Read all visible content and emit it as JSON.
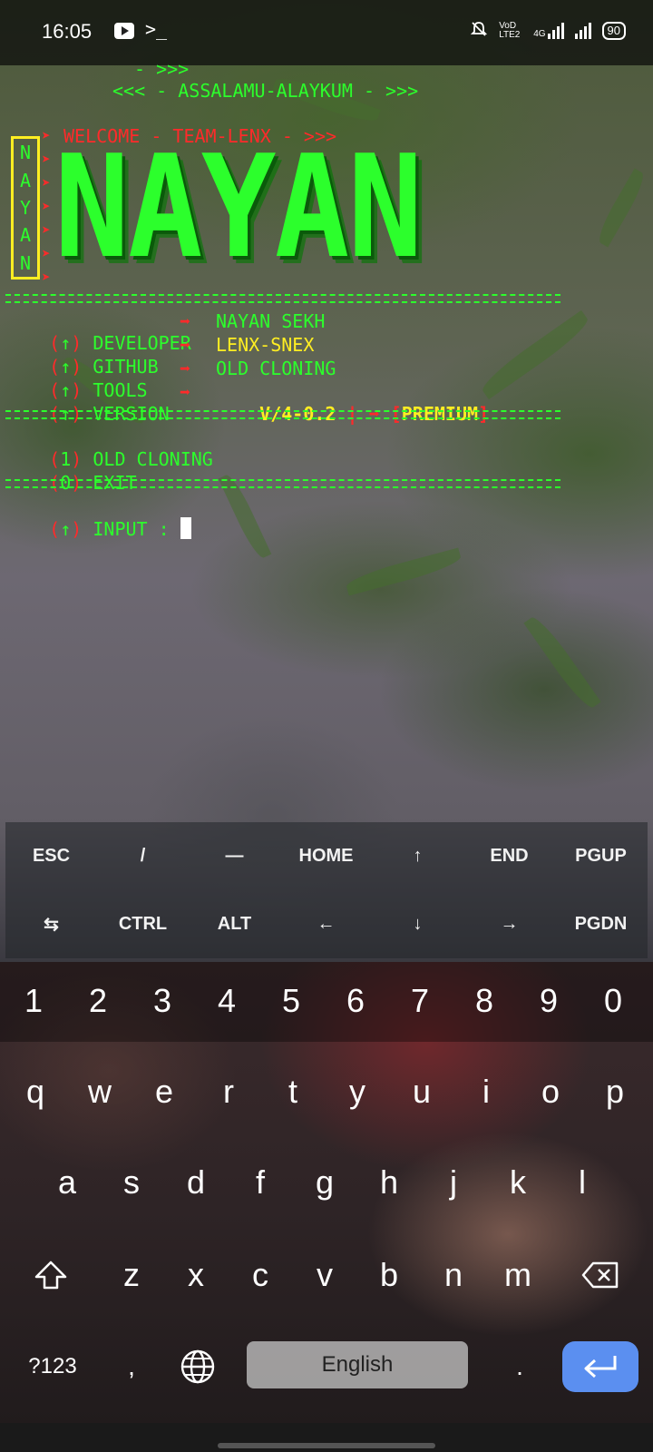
{
  "status_bar": {
    "time": "16:05",
    "network_label": "VoD LTE2",
    "signal_label": "4G",
    "battery": "90",
    "icons": [
      "youtube-icon",
      "terminal-icon",
      "mute-bell-icon",
      "signal-icon",
      "signal-icon",
      "battery-icon"
    ]
  },
  "terminal": {
    "greeting_top": "- >>>",
    "greeting": "<<< - ASSALAMU-ALAYKUM - >>>",
    "welcome": "WELCOME - TEAM-LENX - >>>",
    "side_letters": [
      "N",
      "A",
      "Y",
      "A",
      "N"
    ],
    "logo": "NAYAN",
    "info": [
      {
        "prefix": "(",
        "bullet": "↑",
        "suffix": ")",
        "label": "DEVELOPER",
        "arrow": "➡",
        "value": "NAYAN SEKH",
        "value_color": "green"
      },
      {
        "prefix": "(",
        "bullet": "↑",
        "suffix": ")",
        "label": "GITHUB",
        "arrow": "➡",
        "value": "LENX-SNEX",
        "value_color": "yellow"
      },
      {
        "prefix": "(",
        "bullet": "↑",
        "suffix": ")",
        "label": "TOOLS",
        "arrow": "➡",
        "value": "OLD CLONING",
        "value_color": "green"
      },
      {
        "prefix": "(",
        "bullet": "↑",
        "suffix": ")",
        "label": "VERSION",
        "arrow": "➡",
        "value": "V/4-0.2",
        "value_color": "yellow"
      }
    ],
    "version_extra": {
      "sep": "|",
      "arrow": "➡",
      "open": "[",
      "tag": "PREMIUM",
      "close": "]"
    },
    "menu": [
      {
        "key": "1",
        "label": "OLD CLONING"
      },
      {
        "key": "0",
        "label": "EXIT"
      }
    ],
    "input_label": "INPUT :",
    "input_bullet": "↑"
  },
  "extra_keys": {
    "row1": [
      "ESC",
      "/",
      "—",
      "HOME",
      "↑",
      "END",
      "PGUP"
    ],
    "row2": [
      "⇆",
      "CTRL",
      "ALT",
      "←",
      "↓",
      "→",
      "PGDN"
    ]
  },
  "keyboard": {
    "numbers": [
      "1",
      "2",
      "3",
      "4",
      "5",
      "6",
      "7",
      "8",
      "9",
      "0"
    ],
    "row1": [
      "q",
      "w",
      "e",
      "r",
      "t",
      "y",
      "u",
      "i",
      "o",
      "p"
    ],
    "row2": [
      "a",
      "s",
      "d",
      "f",
      "g",
      "h",
      "j",
      "k",
      "l"
    ],
    "row3": [
      "z",
      "x",
      "c",
      "v",
      "b",
      "n",
      "m"
    ],
    "symbols_label": "?123",
    "comma": ",",
    "period": ".",
    "space_label": "English",
    "enter_color": "#5b8ff0"
  },
  "colors": {
    "terminal_green": "#2cff2c",
    "terminal_red": "#ff2a2a",
    "terminal_yellow": "#ffee22"
  }
}
